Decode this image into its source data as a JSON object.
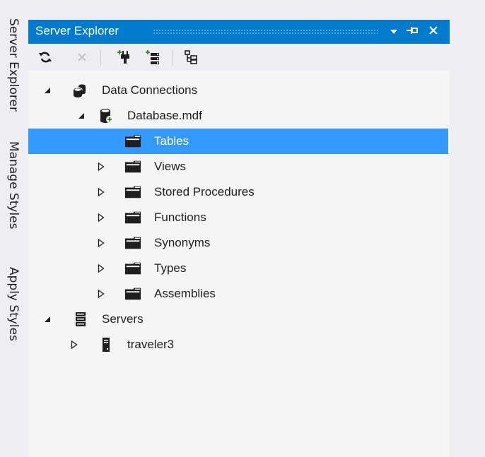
{
  "side_tabs": [
    "Server Explorer",
    "Manage Styles",
    "Apply Styles"
  ],
  "panel": {
    "title": "Server Explorer",
    "title_buttons": [
      "dropdown-icon",
      "pin-icon",
      "close-icon"
    ]
  },
  "toolbar": [
    {
      "name": "refresh-icon",
      "enabled": true
    },
    {
      "name": "stop-icon",
      "enabled": false
    },
    {
      "name": "connect-to-database-icon",
      "enabled": true
    },
    {
      "name": "connect-to-server-icon",
      "enabled": true
    },
    {
      "name": "view-hierarchy-icon",
      "enabled": true
    }
  ],
  "tree": [
    {
      "label": "Data Connections",
      "level": 0,
      "expander": "expanded",
      "icon": "data-connections-icon"
    },
    {
      "label": "Database.mdf",
      "level": 1,
      "expander": "expanded",
      "icon": "database-icon"
    },
    {
      "label": "Tables",
      "level": 2,
      "expander": "none",
      "icon": "folder-icon",
      "selected": true
    },
    {
      "label": "Views",
      "level": 2,
      "expander": "collapsed",
      "icon": "folder-icon"
    },
    {
      "label": "Stored Procedures",
      "level": 2,
      "expander": "collapsed",
      "icon": "folder-icon"
    },
    {
      "label": "Functions",
      "level": 2,
      "expander": "collapsed",
      "icon": "folder-icon"
    },
    {
      "label": "Synonyms",
      "level": 2,
      "expander": "collapsed",
      "icon": "folder-icon"
    },
    {
      "label": "Types",
      "level": 2,
      "expander": "collapsed",
      "icon": "folder-icon"
    },
    {
      "label": "Assemblies",
      "level": 2,
      "expander": "collapsed",
      "icon": "folder-icon"
    },
    {
      "label": "Servers",
      "level": 0,
      "expander": "expanded",
      "icon": "servers-icon"
    },
    {
      "label": "traveler3",
      "level": 1,
      "expander": "collapsed",
      "icon": "server-icon"
    }
  ],
  "colors": {
    "accent": "#007acc",
    "selection": "#3399ff",
    "panel_background": "#f5f5f5",
    "chrome_background": "#eeeef2"
  }
}
